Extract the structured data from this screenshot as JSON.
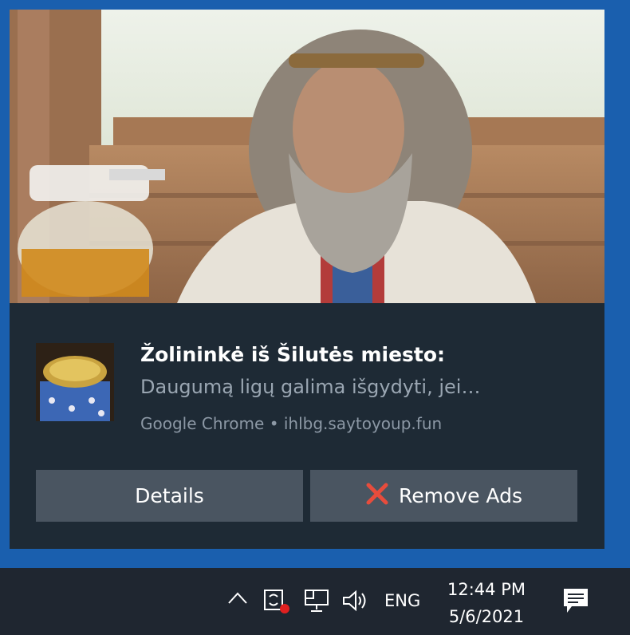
{
  "notification": {
    "title": "Žolininkė iš Šilutės miesto:",
    "message": "Daugumą ligų galima išgydyti, jei…",
    "source": "Google Chrome • ihlbg.saytoyoup.fun",
    "buttons": {
      "details_label": "Details",
      "remove_ads_label": "Remove Ads"
    },
    "icons": {
      "hero": "photo-elderly-bearded-man",
      "thumbnail": "gold-pills-jar-photo",
      "remove_ads_icon": "red-x-icon"
    }
  },
  "taskbar": {
    "language": "ENG",
    "time": "12:44 PM",
    "date": "5/6/2021",
    "icons": [
      "chevron-up-icon",
      "sync-app-icon",
      "network-icon",
      "volume-icon",
      "action-center-icon"
    ]
  },
  "colors": {
    "accent_blue": "#1a5fae",
    "toast_bg": "#1e2a35",
    "button_bg": "#4a5561",
    "taskbar_bg": "#1f2630",
    "red_x": "#e74c3c"
  }
}
